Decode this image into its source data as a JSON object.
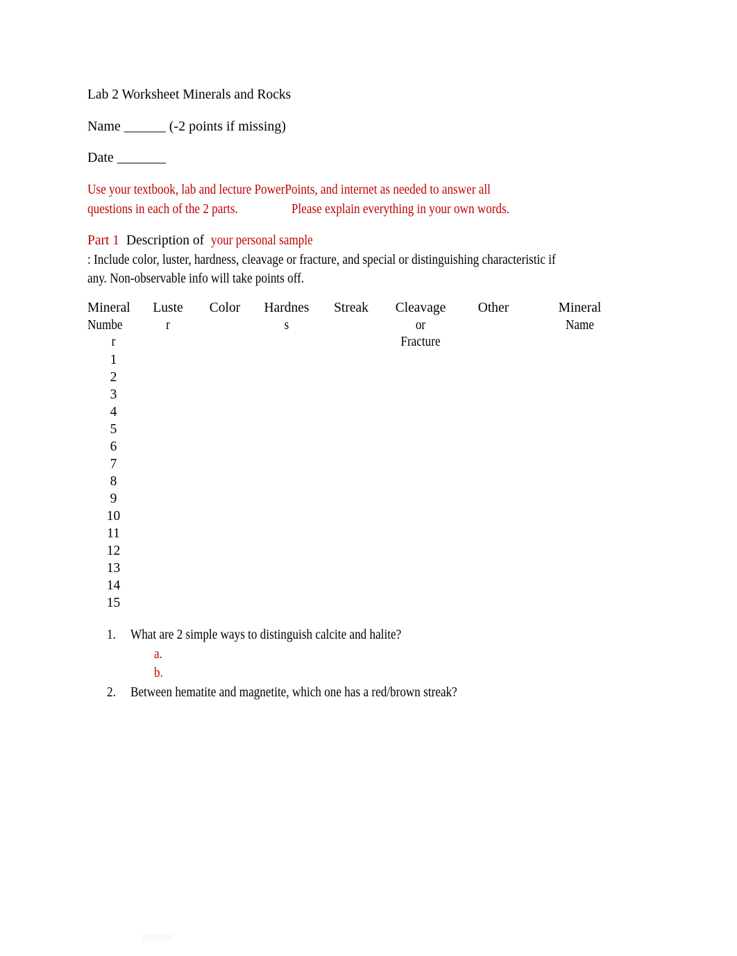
{
  "document": {
    "title": "Lab 2 Worksheet Minerals and Rocks",
    "name_line": "Name ______ (-2 points if missing)",
    "date_line": "Date _______",
    "accent_color": "#C00000",
    "text_color": "#000000",
    "background_color": "#FFFFFF"
  },
  "instructions": {
    "line1": "Use your textbook, lab and lecture PowerPoints, and internet as needed to answer all",
    "line2a": "questions in each of the 2 parts.",
    "line2b": "Please explain everything in your own words."
  },
  "part1": {
    "label": "Part 1",
    "lead": "Description of",
    "emphasis": "your personal sample",
    "body": ": Include color, luster, hardness, cleavage or fracture, and special or distinguishing characteristic if any. Non-observable info will take points off."
  },
  "table": {
    "headers": [
      {
        "line1": "Mineral",
        "line2": "Numbe",
        "line3": "r"
      },
      {
        "line1": "Luste",
        "line2": "r",
        "line3": ""
      },
      {
        "line1": "Color",
        "line2": "",
        "line3": ""
      },
      {
        "line1": "Hardnes",
        "line2": "s",
        "line3": ""
      },
      {
        "line1": "Streak",
        "line2": "",
        "line3": ""
      },
      {
        "line1": "Cleavage",
        "line2": "or",
        "line3": "Fracture"
      },
      {
        "line1": "Other",
        "line2": "",
        "line3": ""
      },
      {
        "line1": "Mineral",
        "line2": "Name",
        "line3": ""
      }
    ],
    "rows": [
      {
        "number": "1",
        "luster": "",
        "color": "",
        "hardness": "",
        "streak": "",
        "cleavage": "",
        "other": "",
        "mineral_name": ""
      },
      {
        "number": "2",
        "luster": "",
        "color": "",
        "hardness": "",
        "streak": "",
        "cleavage": "",
        "other": "",
        "mineral_name": ""
      },
      {
        "number": "3",
        "luster": "",
        "color": "",
        "hardness": "",
        "streak": "",
        "cleavage": "",
        "other": "",
        "mineral_name": ""
      },
      {
        "number": "4",
        "luster": "",
        "color": "",
        "hardness": "",
        "streak": "",
        "cleavage": "",
        "other": "",
        "mineral_name": ""
      },
      {
        "number": "5",
        "luster": "",
        "color": "",
        "hardness": "",
        "streak": "",
        "cleavage": "",
        "other": "",
        "mineral_name": ""
      },
      {
        "number": "6",
        "luster": "",
        "color": "",
        "hardness": "",
        "streak": "",
        "cleavage": "",
        "other": "",
        "mineral_name": ""
      },
      {
        "number": "7",
        "luster": "",
        "color": "",
        "hardness": "",
        "streak": "",
        "cleavage": "",
        "other": "",
        "mineral_name": ""
      },
      {
        "number": "8",
        "luster": "",
        "color": "",
        "hardness": "",
        "streak": "",
        "cleavage": "",
        "other": "",
        "mineral_name": ""
      },
      {
        "number": "9",
        "luster": "",
        "color": "",
        "hardness": "",
        "streak": "",
        "cleavage": "",
        "other": "",
        "mineral_name": ""
      },
      {
        "number": "10",
        "luster": "",
        "color": "",
        "hardness": "",
        "streak": "",
        "cleavage": "",
        "other": "",
        "mineral_name": ""
      },
      {
        "number": "11",
        "luster": "",
        "color": "",
        "hardness": "",
        "streak": "",
        "cleavage": "",
        "other": "",
        "mineral_name": ""
      },
      {
        "number": "12",
        "luster": "",
        "color": "",
        "hardness": "",
        "streak": "",
        "cleavage": "",
        "other": "",
        "mineral_name": ""
      },
      {
        "number": "13",
        "luster": "",
        "color": "",
        "hardness": "",
        "streak": "",
        "cleavage": "",
        "other": "",
        "mineral_name": ""
      },
      {
        "number": "14",
        "luster": "",
        "color": "",
        "hardness": "",
        "streak": "",
        "cleavage": "",
        "other": "",
        "mineral_name": ""
      },
      {
        "number": "15",
        "luster": "",
        "color": "",
        "hardness": "",
        "streak": "",
        "cleavage": "",
        "other": "",
        "mineral_name": ""
      }
    ]
  },
  "questions": [
    {
      "marker": "1.",
      "text": "What are 2 simple ways to distinguish calcite and halite?",
      "subitems": [
        {
          "marker": "a.",
          "text": ""
        },
        {
          "marker": "b.",
          "text": ""
        }
      ]
    },
    {
      "marker": "2.",
      "text": "Between hematite and magnetite, which one has a red/brown streak?",
      "subitems": []
    }
  ]
}
